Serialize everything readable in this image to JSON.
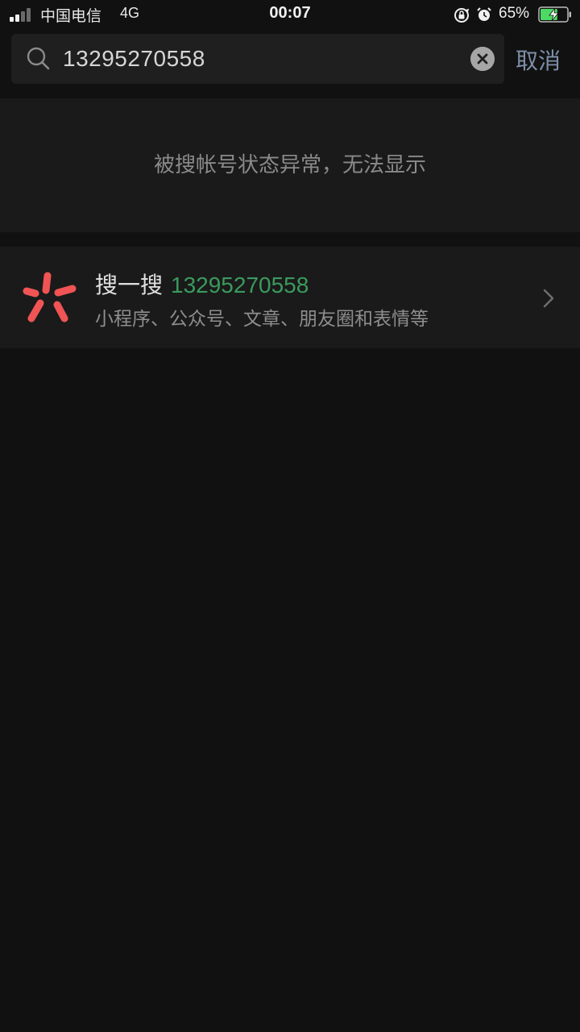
{
  "status_bar": {
    "carrier": "中国电信",
    "network": "4G",
    "time": "00:07",
    "battery_percent": "65%",
    "battery_level": 0.65,
    "icons": [
      "signal-icon",
      "orientation-lock-icon",
      "alarm-icon",
      "battery-charging-icon"
    ]
  },
  "search": {
    "query": "13295270558",
    "cancel_label": "取消",
    "icons": [
      "search-icon",
      "clear-icon"
    ]
  },
  "notice": {
    "text": "被搜帐号状态异常，无法显示"
  },
  "search_one": {
    "prefix": "搜一搜",
    "query": "13295270558",
    "subtitle": "小程序、公众号、文章、朋友圈和表情等",
    "icons": [
      "search-one-logo-icon",
      "chevron-right-icon"
    ]
  },
  "colors": {
    "background": "#111111",
    "panel": "#1a1a1a",
    "search_field": "#1f1f1f",
    "highlight_green": "#3a9a5e",
    "cancel_blue": "#7d90a8",
    "logo_red": "#f05454",
    "battery_green": "#4cd964"
  }
}
